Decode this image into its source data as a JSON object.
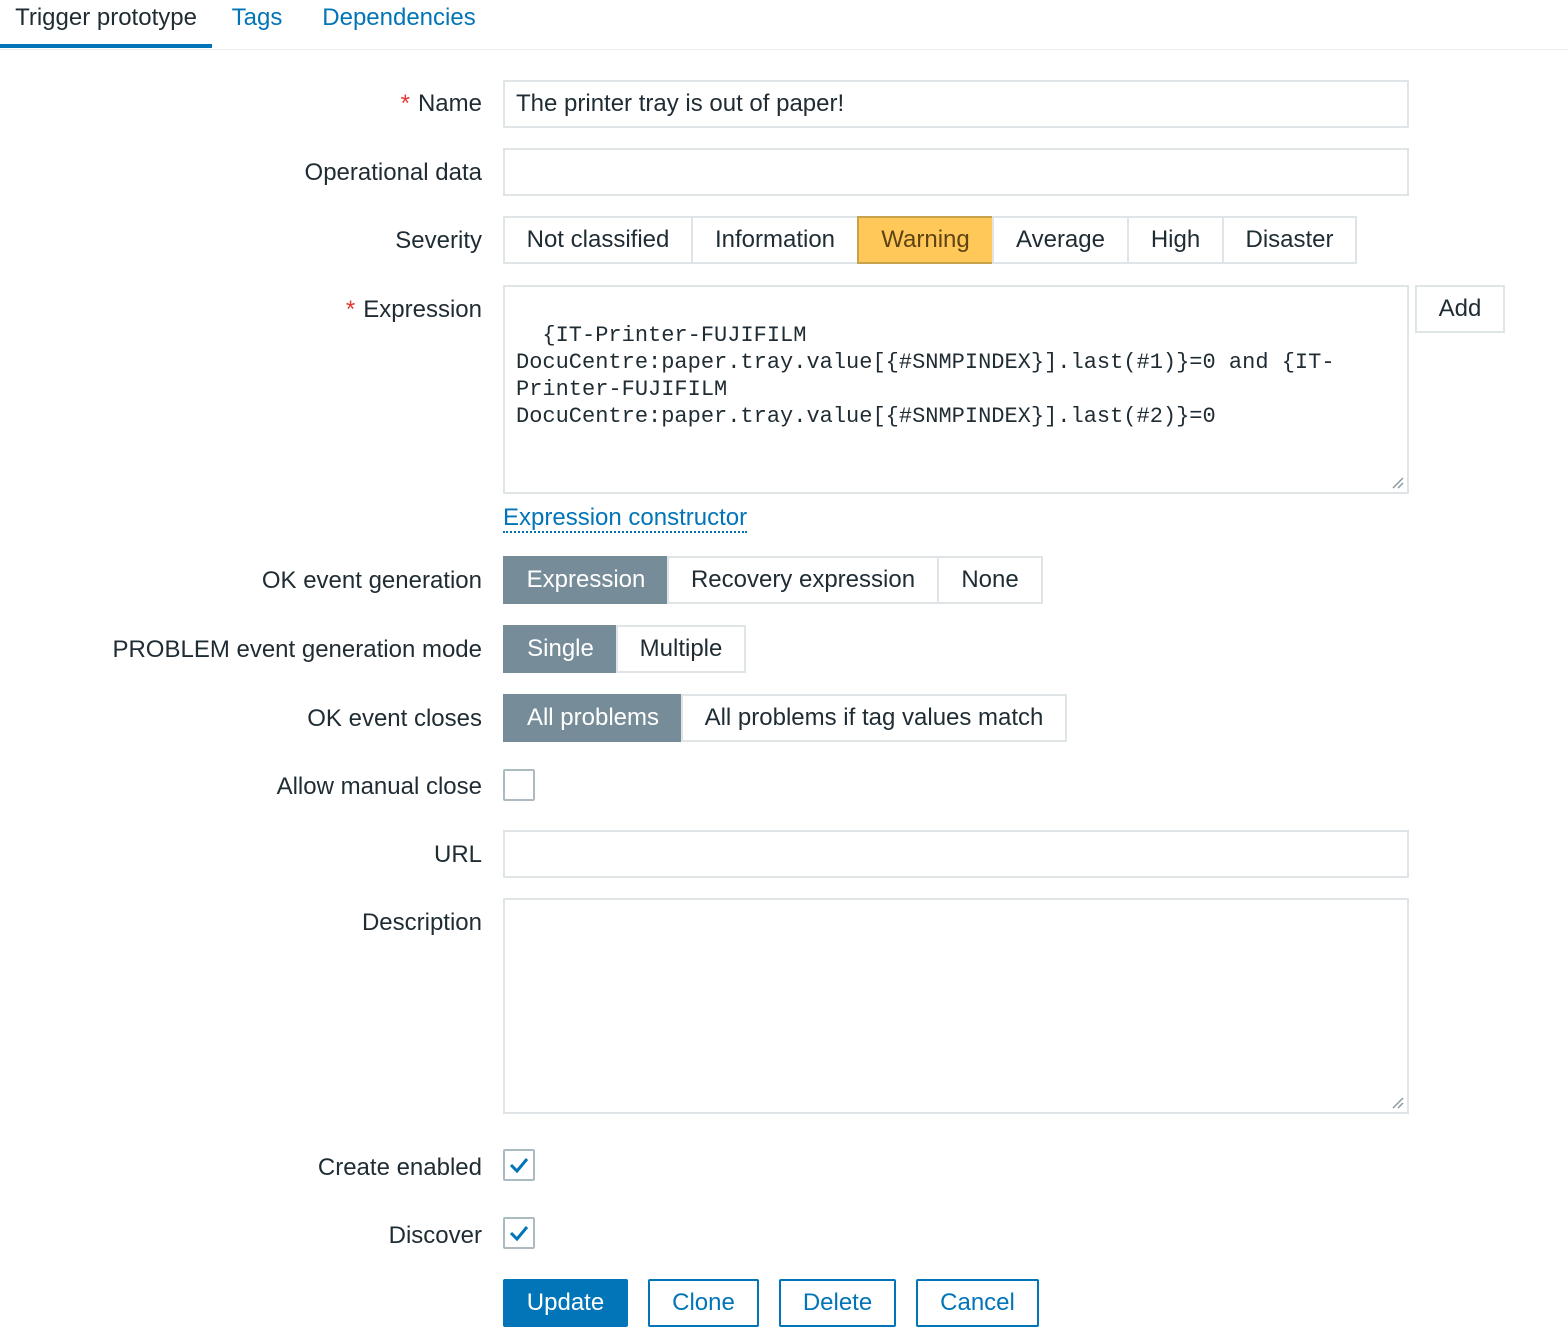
{
  "tabs": [
    {
      "label": "Trigger prototype",
      "active": true
    },
    {
      "label": "Tags",
      "active": false
    },
    {
      "label": "Dependencies",
      "active": false
    }
  ],
  "form": {
    "name": {
      "label": "Name",
      "required": true,
      "value": "The printer tray is out of paper!"
    },
    "operational_data": {
      "label": "Operational data",
      "value": ""
    },
    "severity": {
      "label": "Severity",
      "options": [
        "Not classified",
        "Information",
        "Warning",
        "Average",
        "High",
        "Disaster"
      ],
      "selected": "Warning"
    },
    "expression": {
      "label": "Expression",
      "required": true,
      "value": "{IT-Printer-FUJIFILM DocuCentre:paper.tray.value[{#SNMPINDEX}].last(#1)}=0 and {IT-Printer-FUJIFILM DocuCentre:paper.tray.value[{#SNMPINDEX}].last(#2)}=0",
      "add_label": "Add",
      "constructor_link": "Expression constructor"
    },
    "ok_event_generation": {
      "label": "OK event generation",
      "options": [
        "Expression",
        "Recovery expression",
        "None"
      ],
      "selected": "Expression"
    },
    "problem_mode": {
      "label": "PROBLEM event generation mode",
      "options": [
        "Single",
        "Multiple"
      ],
      "selected": "Single"
    },
    "ok_event_closes": {
      "label": "OK event closes",
      "options": [
        "All problems",
        "All problems if tag values match"
      ],
      "selected": "All problems"
    },
    "allow_manual_close": {
      "label": "Allow manual close",
      "checked": false
    },
    "url": {
      "label": "URL",
      "value": ""
    },
    "description": {
      "label": "Description",
      "value": ""
    },
    "create_enabled": {
      "label": "Create enabled",
      "checked": true
    },
    "discover": {
      "label": "Discover",
      "checked": true
    }
  },
  "buttons": {
    "update": "Update",
    "clone": "Clone",
    "delete": "Delete",
    "cancel": "Cancel"
  },
  "colors": {
    "accent": "#0275b8",
    "warning": "#ffc859",
    "selected_segment": "#768d99",
    "required": "#e33734"
  },
  "icons": [
    "checkmark-icon",
    "resize-handle-icon"
  ]
}
